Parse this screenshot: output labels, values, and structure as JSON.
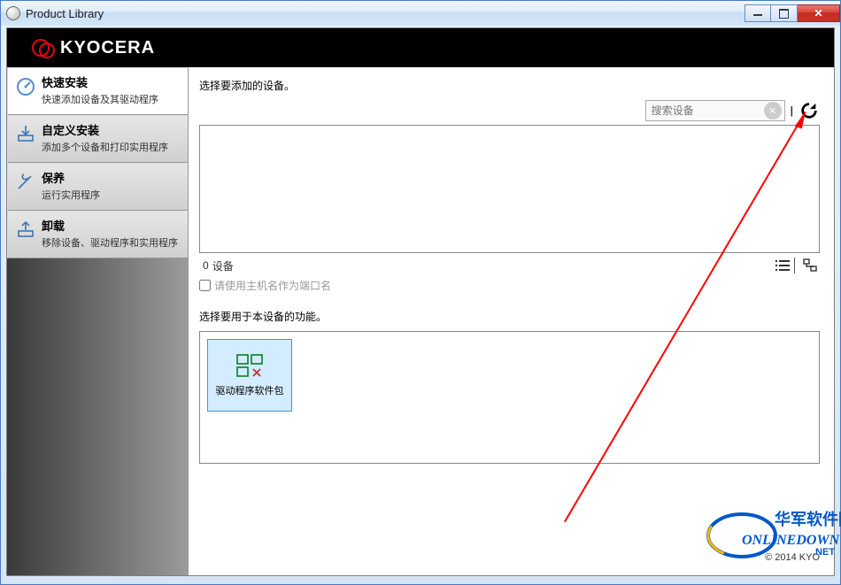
{
  "window": {
    "title": "Product Library"
  },
  "brand": {
    "name": "KYOCERA"
  },
  "sidebar": {
    "items": [
      {
        "title": "快速安装",
        "desc": "快速添加设备及其驱动程序"
      },
      {
        "title": "自定义安装",
        "desc": "添加多个设备和打印实用程序"
      },
      {
        "title": "保养",
        "desc": "运行实用程序"
      },
      {
        "title": "卸载",
        "desc": "移除设备、驱动程序和实用程序"
      }
    ]
  },
  "main": {
    "section1_label": "选择要添加的设备。",
    "search_placeholder": "搜索设备",
    "device_count_prefix": "0",
    "device_count_label": "设备",
    "checkbox_label": "请使用主机名作为端口名",
    "section2_label": "选择要用于本设备的功能。",
    "feature_tile_label": "驱动程序软件包"
  },
  "footer": {
    "copyright": "© 2014 KYO"
  },
  "watermark": {
    "line1": "华军软件园",
    "line2": "ONLINEDOWN",
    "line3": ".NET"
  }
}
